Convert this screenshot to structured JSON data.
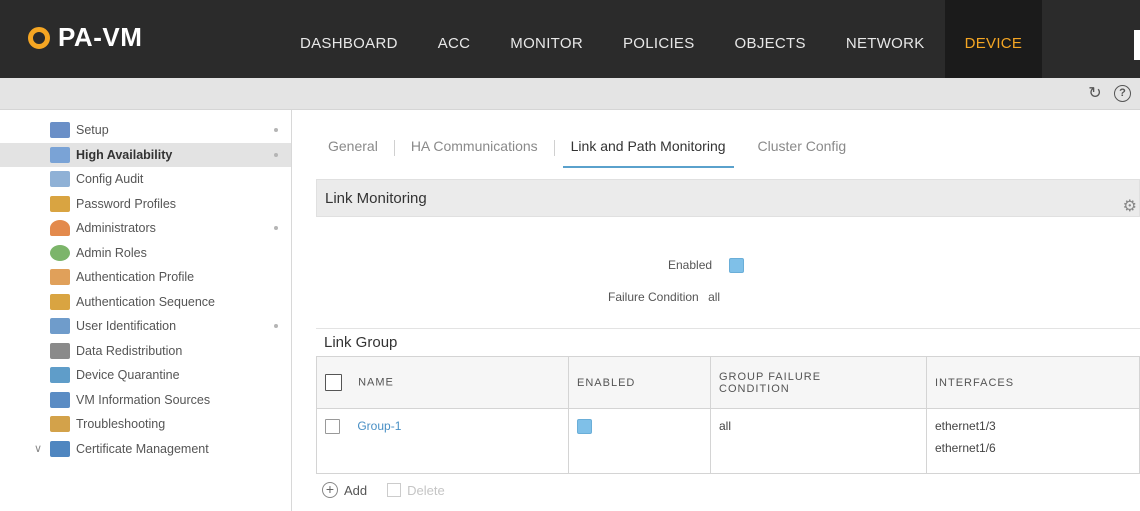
{
  "header": {
    "brand": "PA-VM",
    "nav": [
      "DASHBOARD",
      "ACC",
      "MONITOR",
      "POLICIES",
      "OBJECTS",
      "NETWORK",
      "DEVICE"
    ],
    "active_nav": "DEVICE",
    "accent_color": "#f5a623"
  },
  "subbar": {
    "icons": [
      "refresh-icon",
      "help-icon"
    ]
  },
  "sidebar": {
    "items": [
      {
        "label": "Setup",
        "icon": "setup-icon",
        "color": "#6a8fc7"
      },
      {
        "label": "High Availability",
        "icon": "high-availability-icon",
        "color": "#7aa3d6"
      },
      {
        "label": "Config Audit",
        "icon": "config-audit-icon",
        "color": "#8fb1d6"
      },
      {
        "label": "Password Profiles",
        "icon": "password-profiles-icon",
        "color": "#d9a441"
      },
      {
        "label": "Administrators",
        "icon": "administrators-icon",
        "color": "#e38a4c"
      },
      {
        "label": "Admin Roles",
        "icon": "admin-roles-icon",
        "color": "#7cb56a"
      },
      {
        "label": "Authentication Profile",
        "icon": "authentication-profile-icon",
        "color": "#e0a05a"
      },
      {
        "label": "Authentication Sequence",
        "icon": "authentication-sequence-icon",
        "color": "#d9a441"
      },
      {
        "label": "User Identification",
        "icon": "user-identification-icon",
        "color": "#6f9ccb"
      },
      {
        "label": "Data Redistribution",
        "icon": "data-redistribution-icon",
        "color": "#8a8a8a"
      },
      {
        "label": "Device Quarantine",
        "icon": "device-quarantine-icon",
        "color": "#5f9dc9"
      },
      {
        "label": "VM Information Sources",
        "icon": "vm-information-sources-icon",
        "color": "#5a8cc4"
      },
      {
        "label": "Troubleshooting",
        "icon": "troubleshooting-icon",
        "color": "#d3a24a"
      },
      {
        "label": "Certificate Management",
        "icon": "certificate-management-icon",
        "color": "#4f86c0"
      }
    ],
    "active_label": "High Availability"
  },
  "tabs": {
    "items": [
      "General",
      "HA Communications",
      "Link and Path Monitoring",
      "Cluster Config"
    ],
    "active": "Link and Path Monitoring"
  },
  "link_monitoring": {
    "title": "Link Monitoring",
    "enabled_label": "Enabled",
    "enabled": true,
    "failure_condition_label": "Failure Condition",
    "failure_condition_value": "all"
  },
  "link_group": {
    "title": "Link Group",
    "columns": [
      "NAME",
      "ENABLED",
      "GROUP FAILURE CONDITION",
      "INTERFACES"
    ],
    "rows": [
      {
        "name": "Group-1",
        "enabled": true,
        "condition": "all",
        "interfaces": [
          "ethernet1/3",
          "ethernet1/6"
        ]
      }
    ]
  },
  "actions": {
    "add": "Add",
    "delete": "Delete"
  }
}
